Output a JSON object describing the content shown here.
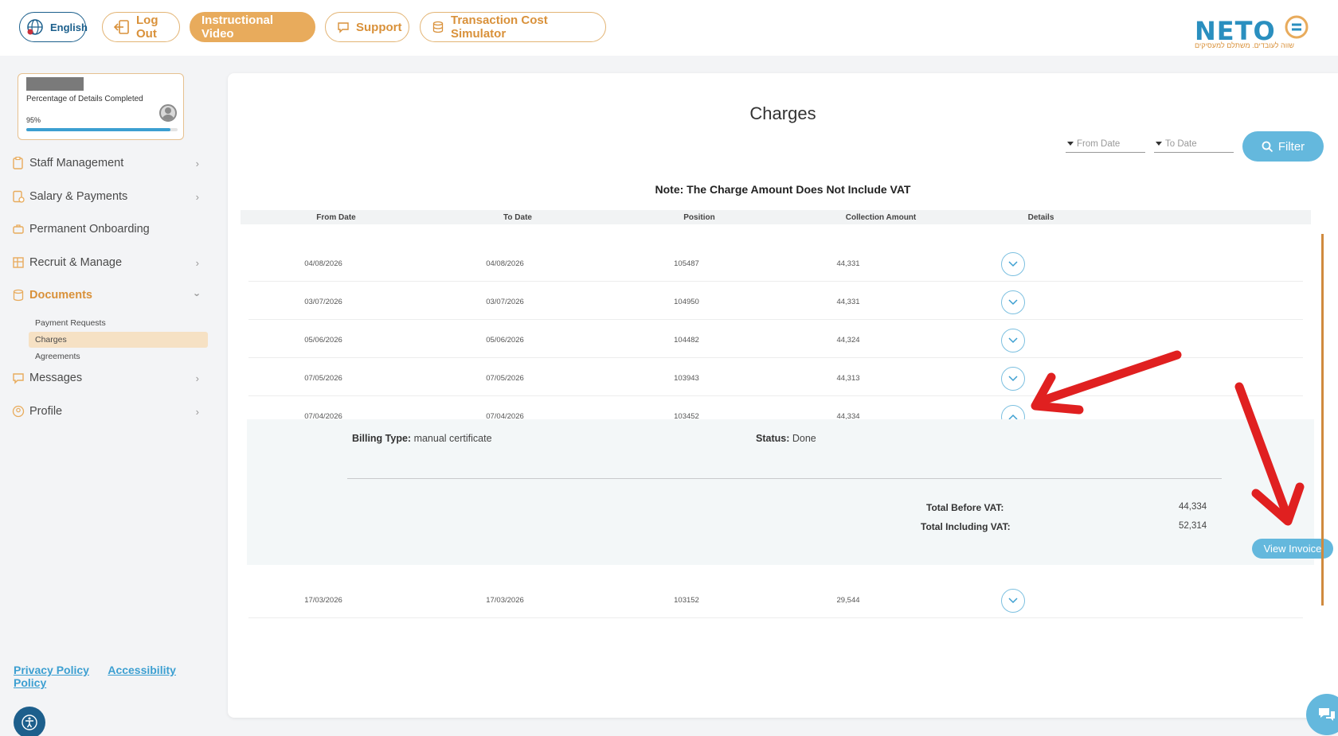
{
  "topbar": {
    "language": "English",
    "logout": "Log Out",
    "instructional_video": "Instructional Video",
    "support": "Support",
    "simulator": "Transaction Cost Simulator",
    "logo_text": "NETO",
    "logo_tagline": "שווה לעובדים. משתלם למעסיקים"
  },
  "profile": {
    "completion_label": "Percentage of Details Completed",
    "completion_value": "95%",
    "completion_fraction": 0.95
  },
  "sidebar": {
    "items": [
      {
        "label": "Staff Management",
        "icon": "clipboard-icon",
        "chevron": true
      },
      {
        "label": "Salary & Payments",
        "icon": "payments-icon",
        "chevron": true
      },
      {
        "label": "Permanent Onboarding",
        "icon": "briefcase-icon",
        "chevron": false
      },
      {
        "label": "Recruit & Manage",
        "icon": "grid-icon",
        "chevron": true
      },
      {
        "label": "Documents",
        "icon": "documents-icon",
        "chevron": true,
        "active": true
      },
      {
        "label": "Messages",
        "icon": "chat-icon",
        "chevron": true
      },
      {
        "label": "Profile",
        "icon": "user-icon",
        "chevron": true
      }
    ],
    "documents_subitems": [
      "Payment Requests",
      "Charges",
      "Agreements"
    ],
    "selected_subitem": "Charges"
  },
  "footer": {
    "privacy": "Privacy Policy",
    "accessibility": "Accessibility Policy"
  },
  "main": {
    "title": "Charges",
    "from_date_placeholder": "From Date",
    "to_date_placeholder": "To Date",
    "filter_label": "Filter",
    "note": "Note: The Charge Amount Does Not Include VAT",
    "columns": [
      "From Date",
      "To Date",
      "Position",
      "Collection Amount",
      "Details"
    ],
    "rows": [
      {
        "from": "04/08/2026",
        "to": "04/08/2026",
        "position": "105487",
        "amount": "44,331",
        "expanded": false
      },
      {
        "from": "03/07/2026",
        "to": "03/07/2026",
        "position": "104950",
        "amount": "44,331",
        "expanded": false
      },
      {
        "from": "05/06/2026",
        "to": "05/06/2026",
        "position": "104482",
        "amount": "44,324",
        "expanded": false
      },
      {
        "from": "07/05/2026",
        "to": "07/05/2026",
        "position": "103943",
        "amount": "44,313",
        "expanded": false
      },
      {
        "from": "07/04/2026",
        "to": "07/04/2026",
        "position": "103452",
        "amount": "44,334",
        "expanded": true
      },
      {
        "from": "17/03/2026",
        "to": "17/03/2026",
        "position": "103152",
        "amount": "29,544",
        "expanded": false
      }
    ],
    "expanded_details": {
      "billing_type_label": "Billing Type:",
      "billing_type_value": "manual certificate",
      "status_label": "Status:",
      "status_value": "Done",
      "total_before_vat_label": "Total Before VAT:",
      "total_before_vat_value": "44,334",
      "total_including_vat_label": "Total Including VAT:",
      "total_including_vat_value": "52,314",
      "view_invoice": "View Invoice"
    }
  },
  "colors": {
    "accent_orange": "#e8ab5c",
    "accent_blue": "#64b8dd",
    "annotation_red": "#e02020"
  }
}
